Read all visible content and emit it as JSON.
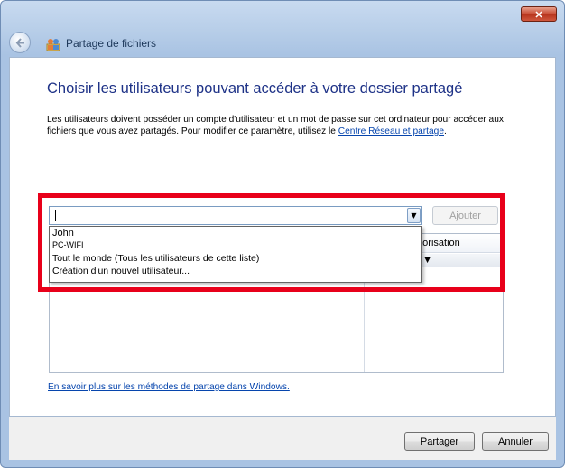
{
  "window": {
    "title": "Partage de fichiers",
    "close_label": "✕"
  },
  "main": {
    "heading": "Choisir les utilisateurs pouvant accéder à votre dossier partagé",
    "description_text": "Les utilisateurs doivent posséder un compte d'utilisateur et un mot de passe sur cet ordinateur pour accéder aux fichiers que vous avez partagés. Pour modifier ce paramètre, utilisez le ",
    "description_link": "Centre Réseau et partage",
    "description_end": "."
  },
  "user_combo": {
    "value": "",
    "add_button": "Ajouter",
    "options": [
      "John",
      "PC-WIFI",
      "Tout le monde (Tous les utilisateurs de cette liste)",
      "Création d'un nouvel utilisateur..."
    ]
  },
  "user_list": {
    "column_permission": "Niveau d'autorisation",
    "column_permission_visible": "utorisation",
    "permission_value_visible": "e ▼"
  },
  "learn_more_link": "En savoir plus sur les méthodes de partage dans Windows.",
  "footer": {
    "share_button": "Partager",
    "cancel_button": "Annuler"
  },
  "colors": {
    "highlight_frame": "#e8001a",
    "heading": "#1e3287",
    "link": "#0645ad"
  }
}
